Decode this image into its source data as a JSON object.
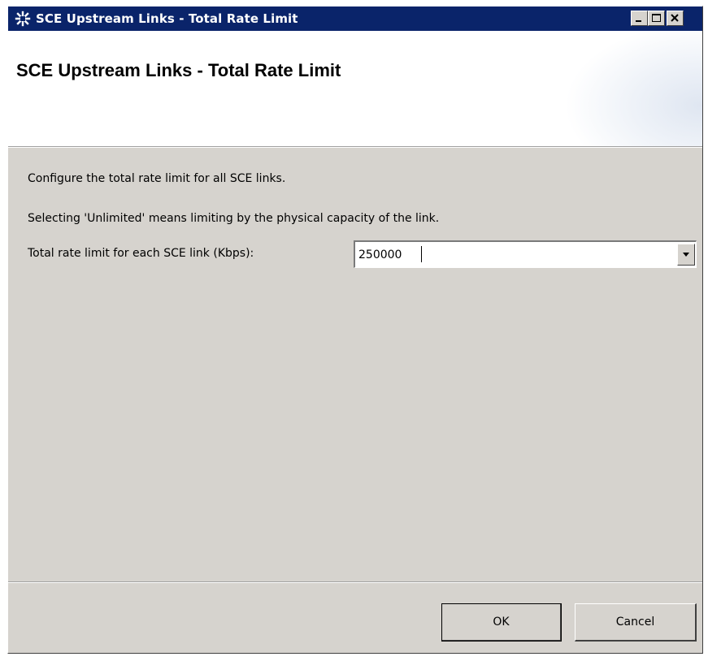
{
  "window": {
    "title": "SCE Upstream Links - Total Rate Limit",
    "icon": "app-logo-icon"
  },
  "header": {
    "title": "SCE Upstream Links - Total Rate Limit"
  },
  "content": {
    "description": "Configure the total rate limit for all SCE links.",
    "note": "Selecting 'Unlimited' means limiting by the physical capacity of the link.",
    "rate_label": "Total rate limit for each SCE link (Kbps):",
    "rate_value": "250000"
  },
  "buttons": {
    "ok": "OK",
    "cancel": "Cancel"
  },
  "colors": {
    "titlebar": "#0a246a",
    "window_bg": "#d6d3ce",
    "header_bg": "#ffffff"
  }
}
